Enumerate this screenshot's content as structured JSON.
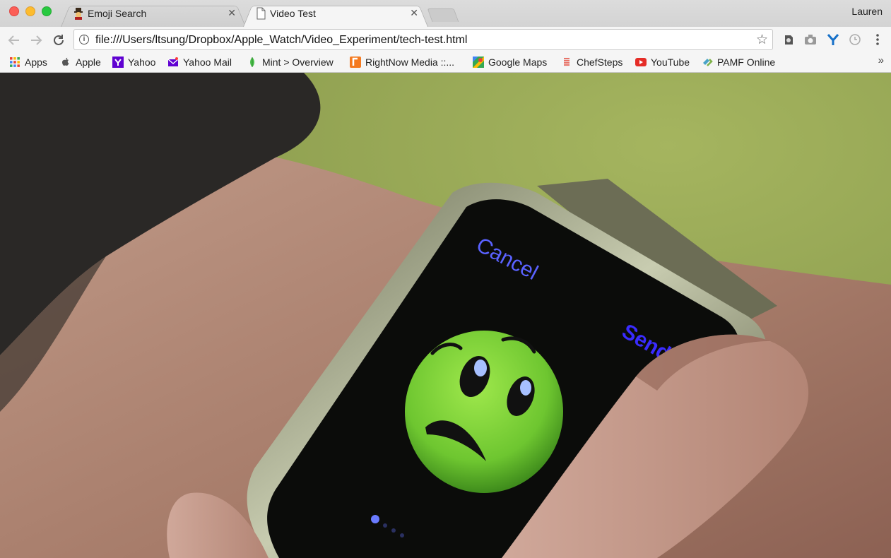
{
  "window": {
    "profile_name": "Lauren"
  },
  "tabs": [
    {
      "label": "Emoji Search",
      "icon": "emoji-favicon",
      "active": false
    },
    {
      "label": "Video Test",
      "icon": "document-icon",
      "active": true
    }
  ],
  "toolbar": {
    "url": "file:///Users/ltsung/Dropbox/Apple_Watch/Video_Experiment/tech-test.html"
  },
  "bookmarks": [
    {
      "label": "Apps",
      "icon": "apps-grid-icon"
    },
    {
      "label": "Apple",
      "icon": "apple-icon"
    },
    {
      "label": "Yahoo",
      "icon": "yahoo-icon"
    },
    {
      "label": "Yahoo Mail",
      "icon": "mail-icon"
    },
    {
      "label": "Mint > Overview",
      "icon": "mint-icon"
    },
    {
      "label": "RightNow Media ::...",
      "icon": "rightnow-icon"
    },
    {
      "label": "Google Maps",
      "icon": "maps-icon"
    },
    {
      "label": "ChefSteps",
      "icon": "chefsteps-icon"
    },
    {
      "label": "YouTube",
      "icon": "youtube-icon"
    },
    {
      "label": "PAMF Online",
      "icon": "pamf-icon"
    }
  ],
  "bookmarks_overflow": "»",
  "video": {
    "watch_cancel_label": "Cancel",
    "watch_send_label": "Send",
    "colors": {
      "background": "#98a957",
      "emoji": "#7cd13a",
      "watch_text": "#4a4dff"
    }
  }
}
